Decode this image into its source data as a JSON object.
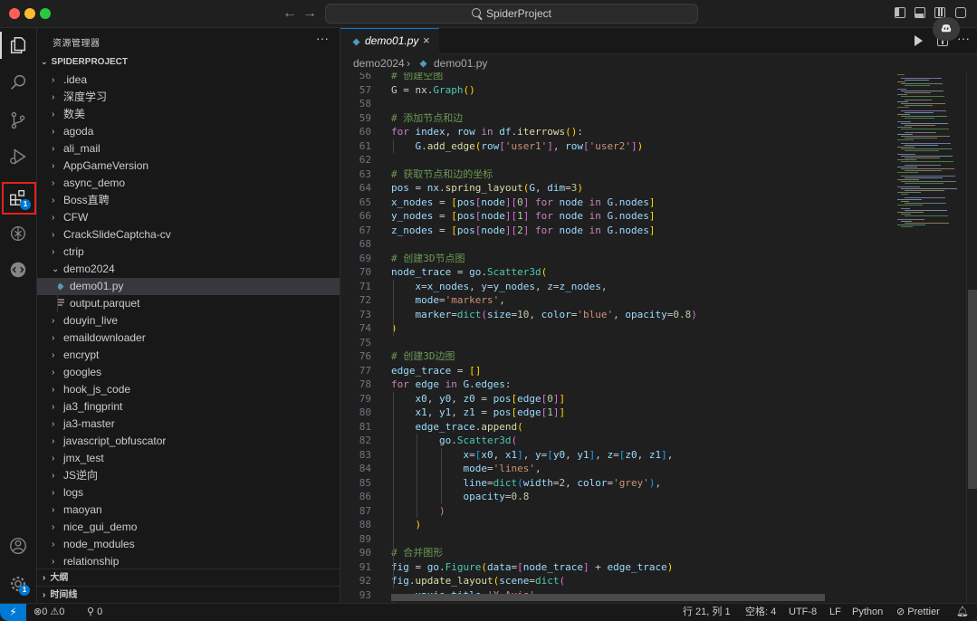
{
  "window": {
    "title": "SpiderProject"
  },
  "titlebar": {
    "back_arrow": "←",
    "forward_arrow": "→"
  },
  "activity_bar": {
    "extensions_badge": "1",
    "settings_badge": "1"
  },
  "sidebar": {
    "title": "资源管理器",
    "more": "···",
    "project": "SPIDERPROJECT",
    "items": [
      {
        "label": ".idea",
        "type": "folder",
        "expanded": false
      },
      {
        "label": "深度学习",
        "type": "folder",
        "expanded": false
      },
      {
        "label": "数美",
        "type": "folder",
        "expanded": false
      },
      {
        "label": "agoda",
        "type": "folder",
        "expanded": false
      },
      {
        "label": "ali_mail",
        "type": "folder",
        "expanded": false
      },
      {
        "label": "AppGameVersion",
        "type": "folder",
        "expanded": false
      },
      {
        "label": "async_demo",
        "type": "folder",
        "expanded": false
      },
      {
        "label": "Boss直聘",
        "type": "folder",
        "expanded": false
      },
      {
        "label": "CFW",
        "type": "folder",
        "expanded": false
      },
      {
        "label": "CrackSlideCaptcha-cv",
        "type": "folder",
        "expanded": false
      },
      {
        "label": "ctrip",
        "type": "folder",
        "expanded": false
      },
      {
        "label": "demo2024",
        "type": "folder",
        "expanded": true
      },
      {
        "label": "demo01.py",
        "type": "py",
        "child": true,
        "active": true
      },
      {
        "label": "output.parquet",
        "type": "file",
        "child": true
      },
      {
        "label": "douyin_live",
        "type": "folder",
        "expanded": false
      },
      {
        "label": "emaildownloader",
        "type": "folder",
        "expanded": false
      },
      {
        "label": "encrypt",
        "type": "folder",
        "expanded": false
      },
      {
        "label": "googles",
        "type": "folder",
        "expanded": false
      },
      {
        "label": "hook_js_code",
        "type": "folder",
        "expanded": false
      },
      {
        "label": "ja3_fingprint",
        "type": "folder",
        "expanded": false
      },
      {
        "label": "ja3-master",
        "type": "folder",
        "expanded": false
      },
      {
        "label": "javascript_obfuscator",
        "type": "folder",
        "expanded": false
      },
      {
        "label": "jmx_test",
        "type": "folder",
        "expanded": false
      },
      {
        "label": "JS逆向",
        "type": "folder",
        "expanded": false
      },
      {
        "label": "logs",
        "type": "folder",
        "expanded": false
      },
      {
        "label": "maoyan",
        "type": "folder",
        "expanded": false
      },
      {
        "label": "nice_gui_demo",
        "type": "folder",
        "expanded": false
      },
      {
        "label": "node_modules",
        "type": "folder",
        "expanded": false
      },
      {
        "label": "relationship",
        "type": "folder",
        "expanded": false
      }
    ],
    "outline": "大纲",
    "timeline": "时间线"
  },
  "editor": {
    "tab_label": "demo01.py",
    "tab_close": "×",
    "breadcrumb_folder": "demo2024",
    "breadcrumb_sep": "›",
    "breadcrumb_file": "demo01.py",
    "lines": [
      {
        "n": "56",
        "html": "<span class='cm'># 创建空图</span>"
      },
      {
        "n": "57",
        "html": "G = nx.<span class='cls'>Graph</span><span class='br1'>()</span>"
      },
      {
        "n": "58",
        "html": ""
      },
      {
        "n": "59",
        "html": "<span class='cm'># 添加节点和边</span>"
      },
      {
        "n": "60",
        "html": "<span class='kw'>for</span> <span class='var'>index</span>, <span class='var'>row</span> <span class='kw'>in</span> <span class='var'>df</span>.<span class='fn'>iterrows</span><span class='br1'>()</span>:"
      },
      {
        "n": "61",
        "html": "    <span class='var'>G</span>.<span class='fn'>add_edge</span><span class='br1'>(</span><span class='var'>row</span><span class='br2'>[</span><span class='str'>'user1'</span><span class='br2'>]</span>, <span class='var'>row</span><span class='br2'>[</span><span class='str'>'user2'</span><span class='br2'>]</span><span class='br1'>)</span>"
      },
      {
        "n": "62",
        "html": ""
      },
      {
        "n": "63",
        "html": "<span class='cm'># 获取节点和边的坐标</span>"
      },
      {
        "n": "64",
        "html": "<span class='var'>pos</span> = <span class='var'>nx</span>.<span class='fn'>spring_layout</span><span class='br1'>(</span><span class='var'>G</span>, <span class='var'>dim</span>=<span class='num'>3</span><span class='br1'>)</span>"
      },
      {
        "n": "65",
        "html": "<span class='var'>x_nodes</span> = <span class='br1'>[</span><span class='var'>pos</span><span class='br2'>[</span><span class='var'>node</span><span class='br2'>]</span><span class='br2'>[</span><span class='num'>0</span><span class='br2'>]</span> <span class='kw'>for</span> <span class='var'>node</span> <span class='kw'>in</span> <span class='var'>G</span>.<span class='var'>nodes</span><span class='br1'>]</span>"
      },
      {
        "n": "66",
        "html": "<span class='var'>y_nodes</span> = <span class='br1'>[</span><span class='var'>pos</span><span class='br2'>[</span><span class='var'>node</span><span class='br2'>]</span><span class='br2'>[</span><span class='num'>1</span><span class='br2'>]</span> <span class='kw'>for</span> <span class='var'>node</span> <span class='kw'>in</span> <span class='var'>G</span>.<span class='var'>nodes</span><span class='br1'>]</span>"
      },
      {
        "n": "67",
        "html": "<span class='var'>z_nodes</span> = <span class='br1'>[</span><span class='var'>pos</span><span class='br2'>[</span><span class='var'>node</span><span class='br2'>]</span><span class='br2'>[</span><span class='num'>2</span><span class='br2'>]</span> <span class='kw'>for</span> <span class='var'>node</span> <span class='kw'>in</span> <span class='var'>G</span>.<span class='var'>nodes</span><span class='br1'>]</span>"
      },
      {
        "n": "68",
        "html": ""
      },
      {
        "n": "69",
        "html": "<span class='cm'># 创建3D节点图</span>"
      },
      {
        "n": "70",
        "html": "<span class='var'>node_trace</span> = <span class='var'>go</span>.<span class='cls'>Scatter3d</span><span class='br1'>(</span>"
      },
      {
        "n": "71",
        "html": "    <span class='var'>x</span>=<span class='var'>x_nodes</span>, <span class='var'>y</span>=<span class='var'>y_nodes</span>, <span class='var'>z</span>=<span class='var'>z_nodes</span>,"
      },
      {
        "n": "72",
        "html": "    <span class='var'>mode</span>=<span class='str'>'markers'</span>,"
      },
      {
        "n": "73",
        "html": "    <span class='var'>marker</span>=<span class='cls'>dict</span><span class='br2'>(</span><span class='var'>size</span>=<span class='num'>10</span>, <span class='var'>color</span>=<span class='str'>'blue'</span>, <span class='var'>opacity</span>=<span class='num'>0.8</span><span class='br2'>)</span>"
      },
      {
        "n": "74",
        "html": "<span class='br1'>)</span>"
      },
      {
        "n": "75",
        "html": ""
      },
      {
        "n": "76",
        "html": "<span class='cm'># 创建3D边图</span>"
      },
      {
        "n": "77",
        "html": "<span class='var'>edge_trace</span> = <span class='br1'>[]</span>"
      },
      {
        "n": "78",
        "html": "<span class='kw'>for</span> <span class='var'>edge</span> <span class='kw'>in</span> <span class='var'>G</span>.<span class='var'>edges</span>:"
      },
      {
        "n": "79",
        "html": "    <span class='var'>x0</span>, <span class='var'>y0</span>, <span class='var'>z0</span> = <span class='var'>pos</span><span class='br1'>[</span><span class='var'>edge</span><span class='br2'>[</span><span class='num'>0</span><span class='br2'>]</span><span class='br1'>]</span>"
      },
      {
        "n": "80",
        "html": "    <span class='var'>x1</span>, <span class='var'>y1</span>, <span class='var'>z1</span> = <span class='var'>pos</span><span class='br1'>[</span><span class='var'>edge</span><span class='br2'>[</span><span class='num'>1</span><span class='br2'>]</span><span class='br1'>]</span>"
      },
      {
        "n": "81",
        "html": "    <span class='var'>edge_trace</span>.<span class='fn'>append</span><span class='br1'>(</span>"
      },
      {
        "n": "82",
        "html": "        <span class='var'>go</span>.<span class='cls'>Scatter3d</span><span class='br2'>(</span>"
      },
      {
        "n": "83",
        "html": "            <span class='var'>x</span>=<span class='br3'>[</span><span class='var'>x0</span>, <span class='var'>x1</span><span class='br3'>]</span>, <span class='var'>y</span>=<span class='br3'>[</span><span class='var'>y0</span>, <span class='var'>y1</span><span class='br3'>]</span>, <span class='var'>z</span>=<span class='br3'>[</span><span class='var'>z0</span>, <span class='var'>z1</span><span class='br3'>]</span>,"
      },
      {
        "n": "84",
        "html": "            <span class='var'>mode</span>=<span class='str'>'lines'</span>,"
      },
      {
        "n": "85",
        "html": "            <span class='var'>line</span>=<span class='cls'>dict</span><span class='br3'>(</span><span class='var'>width</span>=<span class='num'>2</span>, <span class='var'>color</span>=<span class='str'>'grey'</span><span class='br3'>)</span>,"
      },
      {
        "n": "86",
        "html": "            <span class='var'>opacity</span>=<span class='num'>0.8</span>"
      },
      {
        "n": "87",
        "html": "        <span class='br2'>)</span>"
      },
      {
        "n": "88",
        "html": "    <span class='br1'>)</span>"
      },
      {
        "n": "89",
        "html": ""
      },
      {
        "n": "90",
        "html": "<span class='cm'># 合并图形</span>"
      },
      {
        "n": "91",
        "html": "<span class='var'>fig</span> = <span class='var'>go</span>.<span class='cls'>Figure</span><span class='br1'>(</span><span class='var'>data</span>=<span class='br2'>[</span><span class='var'>node_trace</span><span class='br2'>]</span> + <span class='var'>edge_trace</span><span class='br1'>)</span>"
      },
      {
        "n": "92",
        "html": "<span class='var'>fig</span>.<span class='fn'>update_layout</span><span class='br1'>(</span><span class='var'>scene</span>=<span class='cls'>dict</span><span class='br2'>(</span>"
      },
      {
        "n": "93",
        "html": "    <span class='var'>xaxis_title</span>=<span class='str'>'X Axis'</span>,"
      }
    ]
  },
  "statusbar": {
    "remote_icon": "⚡",
    "errors": "0",
    "warnings": "0",
    "ports": "0",
    "position": "行 21, 列 1",
    "spaces": "空格: 4",
    "encoding": "UTF-8",
    "eol": "LF",
    "language": "Python",
    "prettier": "Prettier"
  },
  "colors": {
    "accent": "#0078d4",
    "highlight_box": "#e5211d"
  }
}
